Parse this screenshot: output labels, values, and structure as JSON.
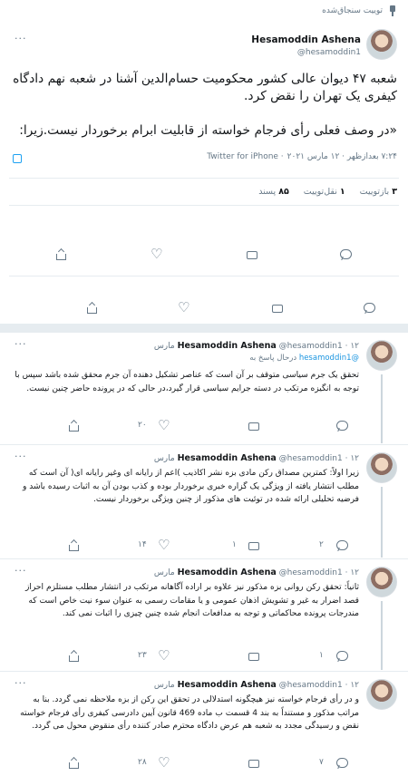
{
  "pinned_label": "توییت سنجاق‌شده",
  "author": {
    "name": "Hesamoddin Ashena",
    "handle": "@hesamoddin1"
  },
  "main_tweet": {
    "paragraph1": "شعبه ۴۷ دیوان عالی کشور محکومیت حسام‌الدین آشنا در شعبه نهم دادگاه کیفری یک تهران را نقض کرد.",
    "paragraph2": "«در وصف فعلی رأی فرجام خواسته از قابلیت ابرام برخوردار نیست.زیرا:",
    "time": "۷:۲۴ بعدازظهر · ۱۲ مارس ۲۰۲۱",
    "source": "· Twitter for iPhone",
    "stats": {
      "quotes_count": "۳",
      "quotes_label": "بازتوییت",
      "retweets_count": "۱",
      "retweets_label": "نقل‌توییت",
      "likes_count": "۸۵",
      "likes_label": "پسند"
    }
  },
  "replies": [
    {
      "date": "· ۱۲ مارس",
      "in_reply_label": "درحال پاسخ به",
      "in_reply_handle": "@hesamoddin1",
      "text": "تحقق یک جرم سیاسی متوقف بر آن است که عناصر تشکیل دهنده آن جرم محقق شده باشد سپس با توجه به انگیزه مرتکب در دسته جرایم سیاسی قرار گیرد،در حالی که در پرونده حاضر چنین نیست.",
      "replies": "",
      "retweets": "",
      "likes": "۲۰"
    },
    {
      "date": "· ۱۲ مارس",
      "text": "زیرا اولاً: کمترین مصداق رکن مادی بزه نشر اکاذیب )اعم از رایانه ای وغیر رایانه ای( آن است که مطلب انتشار یافته از ویژگی یک گزاره خبری برخوردار بوده و کذب بودن آن به اثبات رسیده باشد و فرضیه تحلیلی ارائه شده در توئیت های مذکور از چنین ویژگی برخوردار نیست.",
      "replies": "۲",
      "retweets": "۱",
      "likes": "۱۴"
    },
    {
      "date": "· ۱۲ مارس",
      "text": "ثانیاً: تحقق رکن روانی بزه مذکور نیز علاوه بر اراده آگاهانه مرتکب در انتشار مطلب مستلزم احراز قصد اضرار به غیر و تشویش اذهان عمومی و یا مقامات رسمی به عنوان سوء نیت خاص است که مندرجات پرونده محاکماتی و توجه به مدافعات انجام شده چنین چیزی را اثبات نمی کند.",
      "replies": "۱",
      "retweets": "",
      "likes": "۲۳"
    },
    {
      "date": "· ۱۲ مارس",
      "text": "و در رأی فرجام خواسته نیز هیچگونه استدلالی در تحقق این رکن از بزه ملاحظه نمی گردد. بنا به مراتب مذکور و مستنداً به بند 4 قسمت ب ماده 469 قانون آیین دادرسی کیفری رأی فرجام خواسته نقض و رسیدگی مجدد به شعبه هم عرض دادگاه محترم صادر کننده رأی منقوض محول می گردد.",
      "replies": "۷",
      "retweets": "",
      "likes": "۲۸"
    }
  ]
}
